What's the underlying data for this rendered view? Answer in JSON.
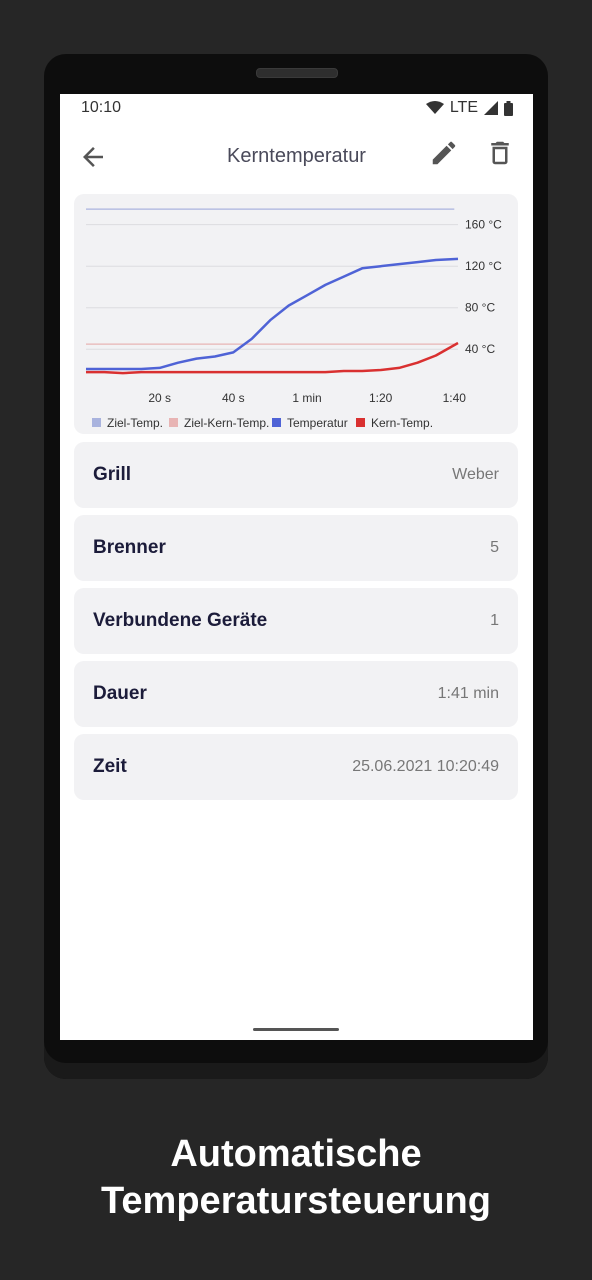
{
  "statusbar": {
    "time": "10:10",
    "network": "LTE"
  },
  "appbar": {
    "title": "Kerntemperatur"
  },
  "icons": {
    "back": "arrow-back-icon",
    "edit": "pencil-icon",
    "delete": "trash-icon"
  },
  "chart_data": {
    "type": "line",
    "xlabel": "",
    "ylabel": "",
    "x_ticks": [
      "20 s",
      "40 s",
      "1 min",
      "1:20",
      "1:40"
    ],
    "x_tick_values": [
      20,
      40,
      60,
      80,
      100
    ],
    "y_ticks": [
      "40 °C",
      "80 °C",
      "120 °C",
      "160 °C"
    ],
    "y_tick_values": [
      40,
      80,
      120,
      160
    ],
    "xlim": [
      0,
      101
    ],
    "ylim": [
      20,
      178
    ],
    "grid": true,
    "legend_position": "bottom",
    "series": [
      {
        "name": "Ziel-Temp.",
        "color": "#a9b3de",
        "x": [
          0,
          100
        ],
        "y": [
          175,
          175
        ]
      },
      {
        "name": "Ziel-Kern-Temp.",
        "color": "#e8b4b4",
        "x": [
          0,
          100
        ],
        "y": [
          45,
          45
        ]
      },
      {
        "name": "Temperatur",
        "color": "#4f63d6",
        "x": [
          0,
          5,
          10,
          15,
          20,
          25,
          30,
          35,
          40,
          45,
          50,
          55,
          60,
          65,
          70,
          75,
          80,
          85,
          90,
          95,
          101
        ],
        "y": [
          21,
          21,
          21,
          21,
          22,
          27,
          31,
          33,
          37,
          50,
          68,
          82,
          92,
          102,
          110,
          118,
          120,
          122,
          124,
          126,
          127
        ]
      },
      {
        "name": "Kern-Temp.",
        "color": "#d93030",
        "x": [
          0,
          5,
          10,
          15,
          20,
          25,
          30,
          35,
          40,
          45,
          50,
          55,
          60,
          65,
          70,
          75,
          80,
          85,
          90,
          95,
          101
        ],
        "y": [
          18,
          18,
          17,
          18,
          18,
          18,
          18,
          18,
          18,
          18,
          18,
          18,
          18,
          18,
          19,
          19,
          20,
          22,
          27,
          34,
          46
        ]
      }
    ]
  },
  "details": [
    {
      "label": "Grill",
      "value": "Weber"
    },
    {
      "label": "Brenner",
      "value": "5"
    },
    {
      "label": "Verbundene Geräte",
      "value": "1"
    },
    {
      "label": "Dauer",
      "value": "1:41 min"
    },
    {
      "label": "Zeit",
      "value": "25.06.2021 10:20:49"
    }
  ],
  "caption": {
    "line1": "Automatische",
    "line2": "Temperatursteuerung"
  }
}
